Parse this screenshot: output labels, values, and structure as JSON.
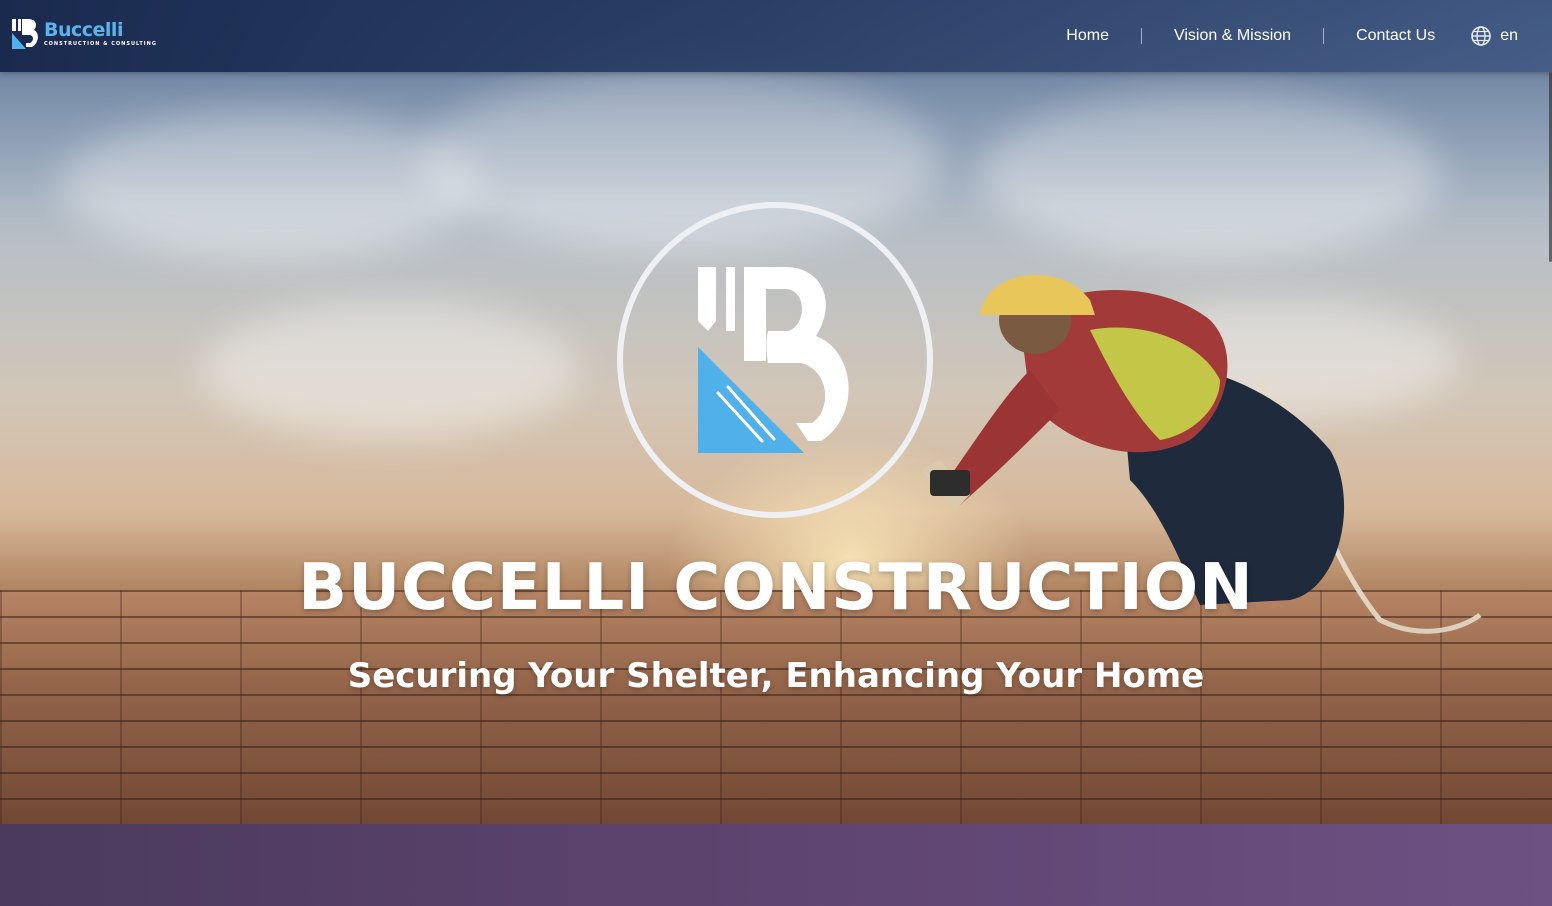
{
  "brand": {
    "name": "Buccelli",
    "tagline": "CONSTRUCTION & CONSULTING",
    "accent_color": "#5ab4ec"
  },
  "nav": {
    "items": [
      {
        "label": "Home"
      },
      {
        "label": "Vision & Mission"
      },
      {
        "label": "Contact Us"
      }
    ],
    "language": {
      "icon": "globe-icon",
      "label": "en"
    }
  },
  "hero": {
    "title": "BUCCELLI CONSTRUCTION",
    "subtitle": "Securing Your Shelter, Enhancing Your Home"
  },
  "colors": {
    "navbar": "#1a2a4f",
    "logo_blue": "#4fb0ea",
    "next_section": "#5e4470"
  }
}
